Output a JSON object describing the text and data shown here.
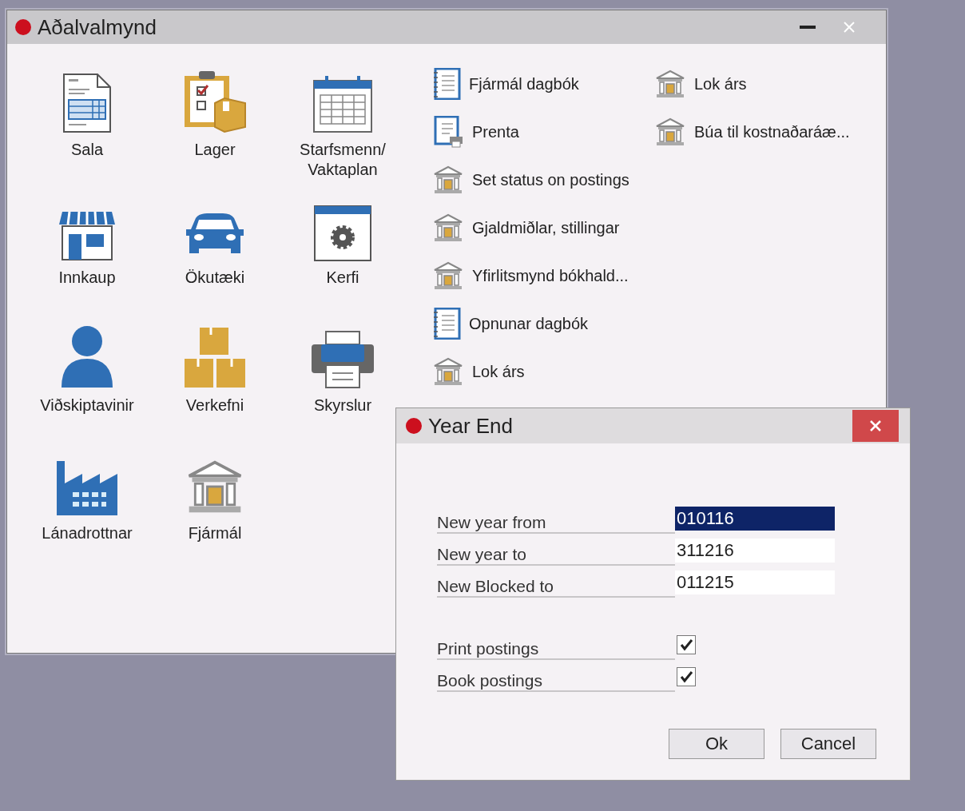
{
  "main_window": {
    "title": "Aðalvalmynd",
    "modules": [
      {
        "label": "Sala",
        "kind": "order"
      },
      {
        "label": "Lager",
        "kind": "clipboard"
      },
      {
        "label": "Starfsmenn/ Vaktaplan",
        "kind": "calendar"
      },
      {
        "label": "Innkaup",
        "kind": "store"
      },
      {
        "label": "Ökutæki",
        "kind": "car"
      },
      {
        "label": "Kerfi",
        "kind": "gear"
      },
      {
        "label": "Viðskiptavinir",
        "kind": "person"
      },
      {
        "label": "Verkefni",
        "kind": "boxes"
      },
      {
        "label": "Skyrslur",
        "kind": "printer"
      },
      {
        "label": "Lánadrottnar",
        "kind": "factory"
      },
      {
        "label": "Fjármál",
        "kind": "bank"
      }
    ],
    "shortcuts": [
      {
        "label": "Fjármál dagbók",
        "kind": "notebook"
      },
      {
        "label": "Prenta",
        "kind": "notebook-print"
      },
      {
        "label": "Set status on postings",
        "kind": "bank"
      },
      {
        "label": "Gjaldmiðlar, stillingar",
        "kind": "bank"
      },
      {
        "label": "Yfirlitsmynd bókhald...",
        "kind": "bank"
      },
      {
        "label": "Opnunar dagbók",
        "kind": "notebook"
      },
      {
        "label": "Lok árs",
        "kind": "bank"
      },
      {
        "label": "Lok árs",
        "kind": "bank"
      },
      {
        "label": "Búa til kostnaðaráæ...",
        "kind": "bank"
      }
    ]
  },
  "dialog": {
    "title": "Year End",
    "fields": [
      {
        "label": "New year from",
        "value": "010116",
        "selected": true
      },
      {
        "label": "New year to",
        "value": "311216",
        "selected": false
      },
      {
        "label": "New Blocked to",
        "value": "011215",
        "selected": false
      }
    ],
    "options": [
      {
        "label": "Print postings",
        "checked": true
      },
      {
        "label": "Book postings",
        "checked": true
      }
    ],
    "buttons": [
      "Ok",
      "Cancel"
    ]
  }
}
